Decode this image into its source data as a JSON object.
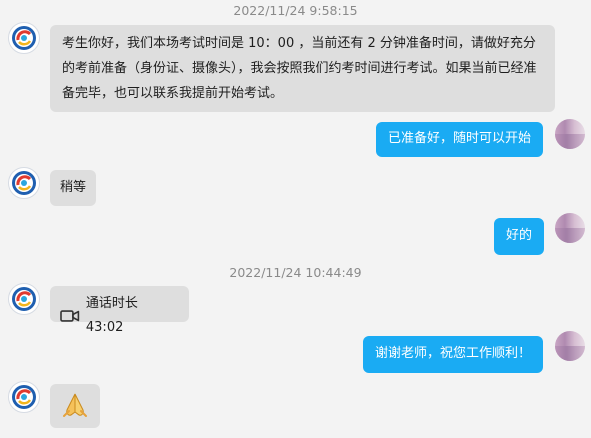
{
  "messages": [
    {
      "type": "timestamp",
      "text": "2022/11/24 9:58:15"
    },
    {
      "type": "incoming",
      "text": "考生你好，我们本场考试时间是 10：00 ，当前还有 2 分钟准备时间，请做好充分的考前准备（身份证、摄像头），我会按照我们约考时间进行考试。如果当前已经准备完毕，也可以联系我提前开始考试。"
    },
    {
      "type": "outgoing",
      "text": "已准备好，随时可以开始"
    },
    {
      "type": "incoming",
      "text": "稍等"
    },
    {
      "type": "outgoing",
      "text": "好的"
    },
    {
      "type": "timestamp",
      "text": "2022/11/24 10:44:49"
    },
    {
      "type": "incoming-call",
      "icon": "video-camera-icon",
      "text": "通话时长 43:02"
    },
    {
      "type": "outgoing",
      "text": "谢谢老师，祝您工作顺利！"
    },
    {
      "type": "incoming-emoji",
      "icon": "folded-hands-icon"
    }
  ],
  "colors": {
    "background": "#f3f3f3",
    "incoming_bubble": "#dedede",
    "outgoing_bubble": "#1aabf3",
    "timestamp_text": "#8a8a8a"
  }
}
